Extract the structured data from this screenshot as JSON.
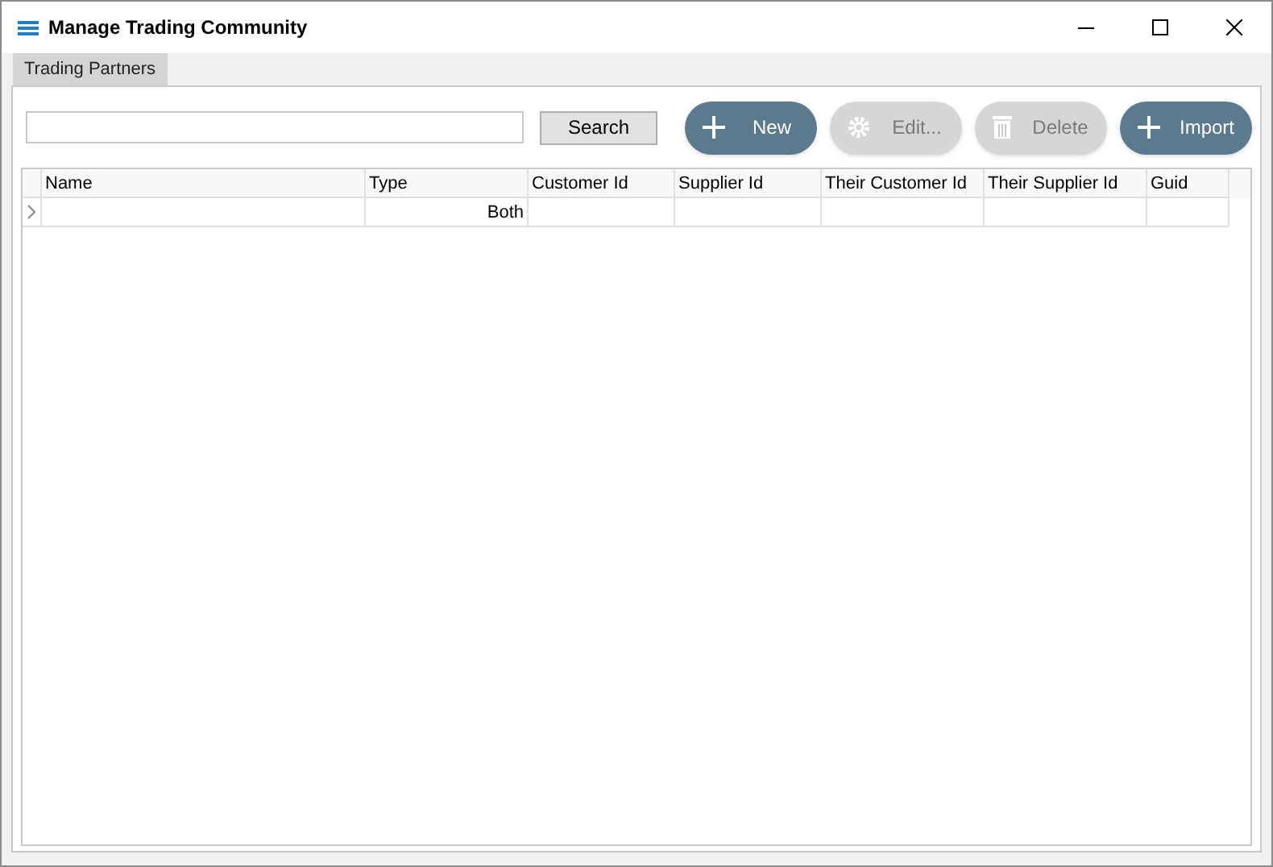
{
  "window": {
    "title": "Manage Trading Community"
  },
  "tabs": [
    {
      "label": "Trading Partners",
      "selected": true
    }
  ],
  "search": {
    "button": "Search"
  },
  "actions": [
    {
      "label": "New",
      "kind": "plus",
      "disabled": false
    },
    {
      "label": "Edit...",
      "kind": "gear",
      "disabled": true
    },
    {
      "label": "Delete",
      "kind": "trash",
      "disabled": true
    },
    {
      "label": "Import",
      "kind": "plus",
      "disabled": false
    }
  ],
  "table": {
    "columns": [
      "Name",
      "Type",
      "Customer Id",
      "Supplier Id",
      "Their Customer Id",
      "Their Supplier Id",
      "Guid"
    ],
    "rows": [
      [
        "",
        "Both",
        "",
        "",
        "",
        "",
        ""
      ]
    ]
  }
}
